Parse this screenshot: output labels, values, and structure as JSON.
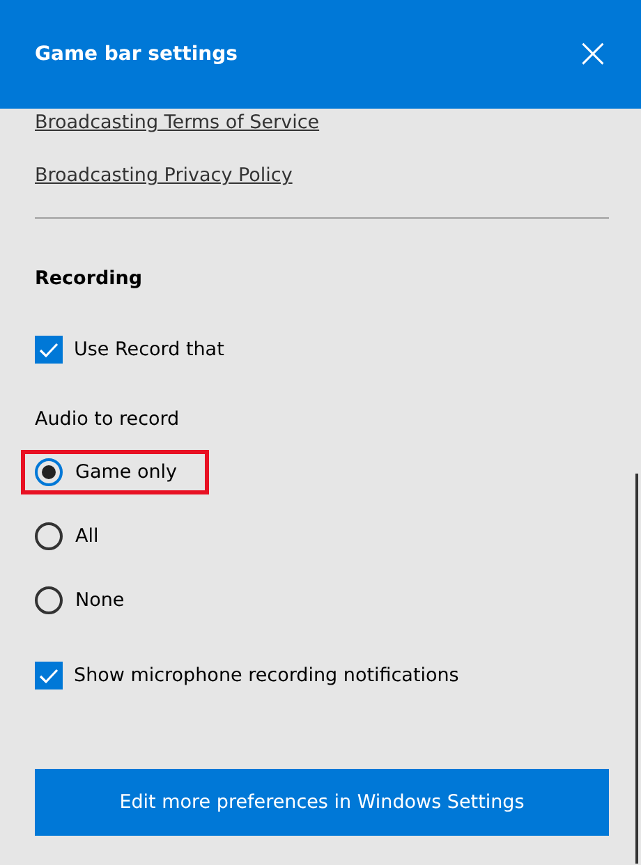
{
  "window": {
    "title": "Game bar settings",
    "close": "×"
  },
  "links": [
    "Broadcasting Terms of Service",
    "Broadcasting Privacy Policy"
  ],
  "section": {
    "title": "Recording"
  },
  "use_record": {
    "label": "Use Record that",
    "checked": true
  },
  "audio": {
    "label": "Audio to record",
    "options": [
      {
        "label": "Game only",
        "selected": true,
        "highlighted": true
      },
      {
        "label": "All",
        "selected": false,
        "highlighted": false
      },
      {
        "label": "None",
        "selected": false,
        "highlighted": false
      }
    ]
  },
  "mic_notifications": {
    "label": "Show microphone recording notifications",
    "checked": true
  },
  "button": "Edit more preferences in Windows Settings"
}
